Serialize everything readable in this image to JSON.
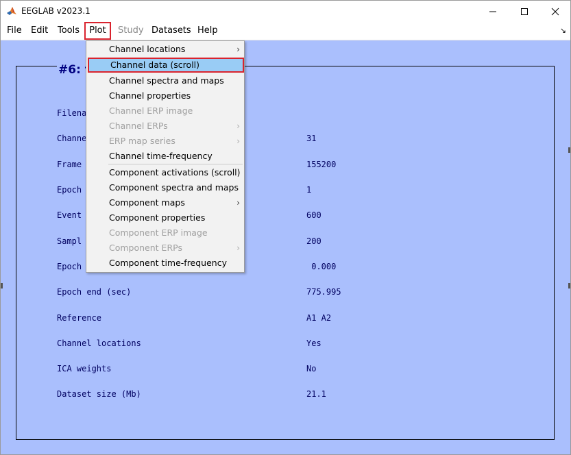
{
  "window": {
    "title": "EEGLAB v2023.1",
    "icon": "matlab-icon"
  },
  "menubar": {
    "items": [
      {
        "label": "File",
        "state": "enabled"
      },
      {
        "label": "Edit",
        "state": "enabled"
      },
      {
        "label": "Tools",
        "state": "enabled"
      },
      {
        "label": "Plot",
        "state": "active"
      },
      {
        "label": "Study",
        "state": "disabled"
      },
      {
        "label": "Datasets",
        "state": "enabled"
      },
      {
        "label": "Help",
        "state": "enabled"
      }
    ],
    "dock_symbol": "↘"
  },
  "dataset": {
    "title": "#6: t",
    "rows": [
      {
        "label": "Filena",
        "value": ""
      },
      {
        "label": "Channe",
        "value": "31"
      },
      {
        "label": "Frame",
        "value": "155200"
      },
      {
        "label": "Epoch",
        "value": "1"
      },
      {
        "label": "Event",
        "value": "600"
      },
      {
        "label": "Sampl",
        "value": "200"
      },
      {
        "label": "Epoch",
        "value": " 0.000"
      },
      {
        "label": "Epoch end (sec)",
        "value": "775.995"
      },
      {
        "label": "Reference",
        "value": "A1 A2"
      },
      {
        "label": "Channel locations",
        "value": "Yes"
      },
      {
        "label": "ICA weights",
        "value": "No"
      },
      {
        "label": "Dataset size (Mb)",
        "value": "21.1"
      }
    ]
  },
  "plot_menu": {
    "items": [
      {
        "label": "Channel locations",
        "enabled": true,
        "submenu": true
      },
      {
        "label": "Channel data (scroll)",
        "enabled": true,
        "submenu": false,
        "highlighted": true
      },
      {
        "label": "Channel spectra and maps",
        "enabled": true,
        "submenu": false
      },
      {
        "label": "Channel properties",
        "enabled": true,
        "submenu": false
      },
      {
        "label": "Channel ERP image",
        "enabled": false,
        "submenu": false
      },
      {
        "label": "Channel ERPs",
        "enabled": false,
        "submenu": true
      },
      {
        "label": "ERP map series",
        "enabled": false,
        "submenu": true
      },
      {
        "label": "Channel time-frequency",
        "enabled": true,
        "submenu": false
      },
      {
        "label": "Component activations (scroll)",
        "enabled": true,
        "submenu": false
      },
      {
        "label": "Component spectra and maps",
        "enabled": true,
        "submenu": false
      },
      {
        "label": "Component maps",
        "enabled": true,
        "submenu": true
      },
      {
        "label": "Component properties",
        "enabled": true,
        "submenu": false
      },
      {
        "label": "Component ERP image",
        "enabled": false,
        "submenu": false
      },
      {
        "label": "Component ERPs",
        "enabled": false,
        "submenu": true
      },
      {
        "label": "Component time-frequency",
        "enabled": true,
        "submenu": false
      }
    ],
    "submenu_arrow": "›"
  },
  "colors": {
    "background_blue": "#aabffd",
    "title_navy": "#000080",
    "highlight_fill": "#99ccf5",
    "highlight_border": "#d9232e"
  }
}
